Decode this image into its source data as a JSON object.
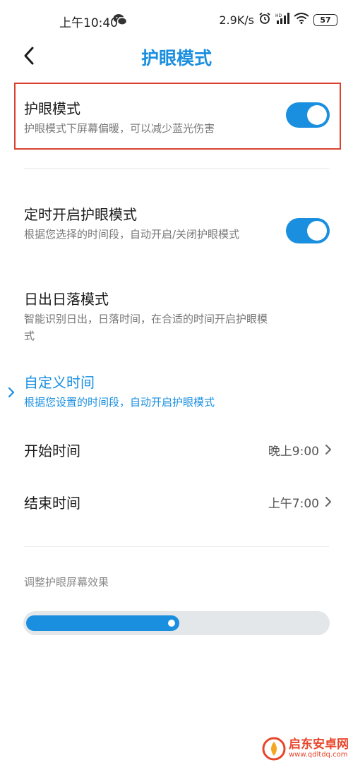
{
  "status_bar": {
    "time": "上午10:40",
    "network_speed": "2.9K/s",
    "battery": "57"
  },
  "header": {
    "title": "护眼模式"
  },
  "eye_mode": {
    "title": "护眼模式",
    "subtitle": "护眼模式下屏幕偏暖，可以减少蓝光伤害",
    "enabled": true
  },
  "schedule": {
    "title": "定时开启护眼模式",
    "subtitle": "根据您选择的时间段，自动开启/关闭护眼模式",
    "enabled": true
  },
  "sunrise_sunset": {
    "title": "日出日落模式",
    "subtitle": "智能识别日出，日落时间，在合适的时间开启护眼模式"
  },
  "custom_time": {
    "title": "自定义时间",
    "subtitle": "根据您设置的时间段，自动开启护眼模式"
  },
  "start_time": {
    "label": "开始时间",
    "value": "晚上9:00"
  },
  "end_time": {
    "label": "结束时间",
    "value": "上午7:00"
  },
  "effect": {
    "caption": "调整护眼屏幕效果",
    "level_percent": 51
  },
  "watermark": {
    "name": "启东安卓网",
    "url": "www.qdltdq.com"
  },
  "colors": {
    "accent": "#1a8fe0",
    "highlight_border": "#d9412e",
    "watermark": "#e8452a"
  }
}
